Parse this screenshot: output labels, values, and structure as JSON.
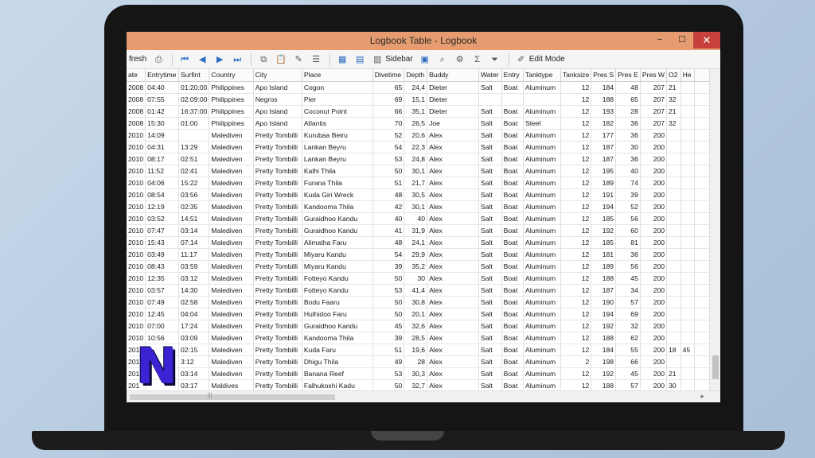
{
  "window": {
    "title": "Logbook Table - Logbook",
    "minimize": "−",
    "maximize": "☐",
    "close": "✕"
  },
  "toolbar": {
    "refresh_label": "fresh",
    "sidebar_label": "Sidebar",
    "edit_mode_label": "Edit Mode",
    "sum_glyph": "Σ"
  },
  "columns": [
    {
      "label": "ate",
      "w": 20
    },
    {
      "label": "Entrytime",
      "w": 42
    },
    {
      "label": "Surfint",
      "w": 38
    },
    {
      "label": "Country",
      "w": 58
    },
    {
      "label": "City",
      "w": 62
    },
    {
      "label": "Place",
      "w": 94
    },
    {
      "label": "Divetime",
      "w": 40
    },
    {
      "label": "Depth",
      "w": 29
    },
    {
      "label": "Buddy",
      "w": 76
    },
    {
      "label": "Water",
      "w": 29
    },
    {
      "label": "Entry",
      "w": 28
    },
    {
      "label": "Tanktype",
      "w": 48
    },
    {
      "label": "Tanksize",
      "w": 38
    },
    {
      "label": "Pres S",
      "w": 29
    },
    {
      "label": "Pres E",
      "w": 29
    },
    {
      "label": "Pres W",
      "w": 31
    },
    {
      "label": "O2",
      "w": 18
    },
    {
      "label": "He",
      "w": 18
    },
    {
      "label": "",
      "w": 40
    }
  ],
  "numeric_columns": [
    6,
    7,
    12,
    13,
    14,
    15
  ],
  "rows": [
    [
      "2008",
      "04:40",
      "01:20:00",
      "Philippines",
      "Apo Island",
      "Cogon",
      "65",
      "24,4",
      "Dieter",
      "Salt",
      "Boat",
      "Aluminum",
      "12",
      "184",
      "48",
      "207",
      "21",
      "",
      ""
    ],
    [
      "2008",
      "07:55",
      "02:09:00",
      "Philippines",
      "Negros",
      "Pier",
      "69",
      "15,1",
      "Dieter",
      "",
      "",
      "",
      "12",
      "188",
      "65",
      "207",
      "32",
      "",
      ""
    ],
    [
      "2008",
      "01:42",
      "16:37:00",
      "Philippines",
      "Apo Island",
      "Coconut Point",
      "66",
      "35,1",
      "Dieter",
      "Salt",
      "Boat",
      "Aluminum",
      "12",
      "193",
      "28",
      "207",
      "21",
      "",
      ""
    ],
    [
      "2008",
      "15:30",
      "01:00",
      "Philippines",
      "Apo Island",
      "Atlantis",
      "70",
      "26,5",
      "Joe",
      "Salt",
      "Boat",
      "Steel",
      "12",
      "182",
      "36",
      "207",
      "32",
      "",
      ""
    ],
    [
      "2010",
      "14:09",
      "",
      "Malediven",
      "Pretty Tombilli",
      "Kurubaa Beiru",
      "52",
      "20,6",
      "Alex",
      "Salt",
      "Boat",
      "Aluminum",
      "12",
      "177",
      "36",
      "200",
      "",
      "",
      ""
    ],
    [
      "2010",
      "04:31",
      "13:29",
      "Malediven",
      "Pretty Tombilli",
      "Lankan Beyru",
      "54",
      "22,3",
      "Alex",
      "Salt",
      "Boat",
      "Aluminum",
      "12",
      "187",
      "30",
      "200",
      "",
      "",
      ""
    ],
    [
      "2010",
      "08:17",
      "02:51",
      "Malediven",
      "Pretty Tombilli",
      "Lankan Beyru",
      "53",
      "24,8",
      "Alex",
      "Salt",
      "Boat",
      "Aluminum",
      "12",
      "187",
      "36",
      "200",
      "",
      "",
      ""
    ],
    [
      "2010",
      "11:52",
      "02:41",
      "Malediven",
      "Pretty Tombilli",
      "Kalhi Thila",
      "50",
      "30,1",
      "Alex",
      "Salt",
      "Boat",
      "Aluminum",
      "12",
      "195",
      "40",
      "200",
      "",
      "",
      ""
    ],
    [
      "2010",
      "04:06",
      "15:22",
      "Malediven",
      "Pretty Tombilli",
      "Furana Thila",
      "51",
      "21,7",
      "Alex",
      "Salt",
      "Boat",
      "Aluminum",
      "12",
      "189",
      "74",
      "200",
      "",
      "",
      ""
    ],
    [
      "2010",
      "08:54",
      "03:56",
      "Malediven",
      "Pretty Tombilli",
      "Kuda Giri Wreck",
      "48",
      "30,5",
      "Alex",
      "Salt",
      "Boat",
      "Aluminum",
      "12",
      "191",
      "39",
      "200",
      "",
      "",
      ""
    ],
    [
      "2010",
      "12:19",
      "02:35",
      "Malediven",
      "Pretty Tombilli",
      "Kandooma Thila",
      "42",
      "30,1",
      "Alex",
      "Salt",
      "Boat",
      "Aluminum",
      "12",
      "194",
      "52",
      "200",
      "",
      "",
      ""
    ],
    [
      "2010",
      "03:52",
      "14:51",
      "Malediven",
      "Pretty Tombilli",
      "Guraidhoo Kandu",
      "40",
      "40",
      "Alex",
      "Salt",
      "Boat",
      "Aluminum",
      "12",
      "185",
      "56",
      "200",
      "",
      "",
      ""
    ],
    [
      "2010",
      "07:47",
      "03:14",
      "Malediven",
      "Pretty Tombilli",
      "Guraidhoo Kandu",
      "41",
      "31,9",
      "Alex",
      "Salt",
      "Boat",
      "Aluminum",
      "12",
      "192",
      "60",
      "200",
      "",
      "",
      ""
    ],
    [
      "2010",
      "15:43",
      "07:14",
      "Malediven",
      "Pretty Tombilli",
      "Alimatha Faru",
      "48",
      "24,1",
      "Alex",
      "Salt",
      "Boat",
      "Aluminum",
      "12",
      "185",
      "81",
      "200",
      "",
      "",
      ""
    ],
    [
      "2010",
      "03:49",
      "11:17",
      "Malediven",
      "Pretty Tombilli",
      "Miyaru Kandu",
      "54",
      "29,9",
      "Alex",
      "Salt",
      "Boat",
      "Aluminum",
      "12",
      "181",
      "36",
      "200",
      "",
      "",
      ""
    ],
    [
      "2010",
      "08:43",
      "03:59",
      "Malediven",
      "Pretty Tombilli",
      "Miyaru Kandu",
      "39",
      "35,2",
      "Alex",
      "Salt",
      "Boat",
      "Aluminum",
      "12",
      "189",
      "56",
      "200",
      "",
      "",
      ""
    ],
    [
      "2010",
      "12:35",
      "03:12",
      "Malediven",
      "Pretty Tombilli",
      "Fotteyo Kandu",
      "50",
      "30",
      "Alex",
      "Salt",
      "Boat",
      "Aluminum",
      "12",
      "188",
      "45",
      "200",
      "",
      "",
      ""
    ],
    [
      "2010",
      "03:57",
      "14:30",
      "Malediven",
      "Pretty Tombilli",
      "Fotteyo Kandu",
      "53",
      "41,4",
      "Alex",
      "Salt",
      "Boat",
      "Aluminum",
      "12",
      "187",
      "34",
      "200",
      "",
      "",
      ""
    ],
    [
      "2010",
      "07:49",
      "02:58",
      "Malediven",
      "Pretty Tombilli",
      "Bodu Faaru",
      "50",
      "30,8",
      "Alex",
      "Salt",
      "Boat",
      "Aluminum",
      "12",
      "190",
      "57",
      "200",
      "",
      "",
      ""
    ],
    [
      "2010",
      "12:45",
      "04:04",
      "Malediven",
      "Pretty Tombilli",
      "Hulhidoo Faru",
      "50",
      "20,1",
      "Alex",
      "Salt",
      "Boat",
      "Aluminum",
      "12",
      "194",
      "69",
      "200",
      "",
      "",
      ""
    ],
    [
      "2010",
      "07:00",
      "17:24",
      "Malediven",
      "Pretty Tombilli",
      "Guraidhoo Kandu",
      "45",
      "32,6",
      "Alex",
      "Salt",
      "Boat",
      "Aluminum",
      "12",
      "192",
      "32",
      "200",
      "",
      "",
      ""
    ],
    [
      "2010",
      "10:56",
      "03:09",
      "Malediven",
      "Pretty Tombilli",
      "Kandooma Thila",
      "39",
      "28,5",
      "Alex",
      "Salt",
      "Boat",
      "Aluminum",
      "12",
      "188",
      "62",
      "200",
      "",
      "",
      ""
    ],
    [
      "201",
      "",
      "02:15",
      "Malediven",
      "Pretty Tombilli",
      "Kuda Faru",
      "51",
      "19,6",
      "Alex",
      "Salt",
      "Boat",
      "Aluminum",
      "12",
      "184",
      "55",
      "200",
      "18",
      "45",
      ""
    ],
    [
      "201",
      "",
      "3:12",
      "Malediven",
      "Pretty Tombilli",
      "Dhigu Thila",
      "49",
      "28",
      "Alex",
      "Salt",
      "Boat",
      "Aluminum",
      "2",
      "198",
      "66",
      "200",
      "",
      "",
      ""
    ],
    [
      "201",
      "",
      "03:14",
      "Malediven",
      "Pretty Tombilli",
      "Banana Reef",
      "53",
      "30,3",
      "Alex",
      "Salt",
      "Boat",
      "Aluminum",
      "12",
      "192",
      "45",
      "200",
      "21",
      "",
      ""
    ],
    [
      "201",
      "",
      "03:17",
      "Maldives",
      "Pretty Tombilli",
      "Falhukoshi Kadu",
      "50",
      "32,7",
      "Alex",
      "Salt",
      "Boat",
      "Aluminum",
      "12",
      "188",
      "57",
      "200",
      "30",
      "",
      ""
    ]
  ],
  "logo_letter": "N"
}
